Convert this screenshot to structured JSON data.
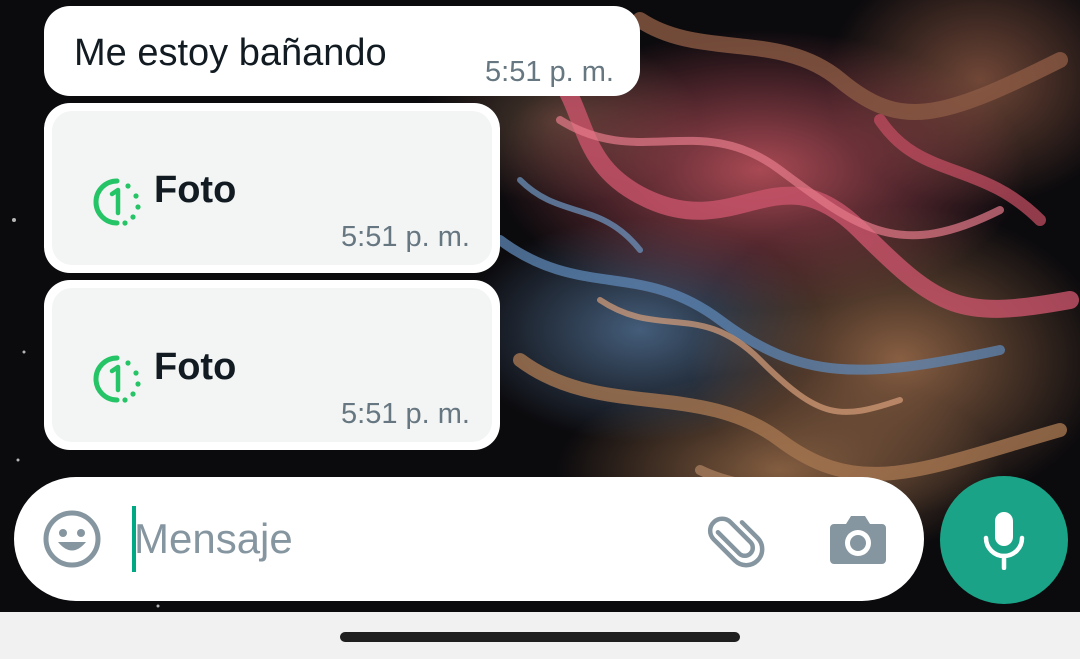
{
  "messages": [
    {
      "type": "text",
      "text": "Me estoy bañando",
      "time": "5:51 p. m."
    },
    {
      "type": "photo",
      "icon": "view-once-icon",
      "label": "Foto",
      "time": "5:51 p. m."
    },
    {
      "type": "photo",
      "icon": "view-once-icon",
      "label": "Foto",
      "time": "5:51 p. m."
    }
  ],
  "input_bar": {
    "placeholder": "Mensaje",
    "value": "",
    "icons": [
      "emoji-icon",
      "attach-icon",
      "camera-icon"
    ]
  },
  "send_button": {
    "icon": "microphone-icon"
  },
  "colors": {
    "accent": "#1aa386",
    "view_once": "#25c466",
    "bubble": "#ffffff",
    "text": "#111b21",
    "meta": "#667781"
  }
}
